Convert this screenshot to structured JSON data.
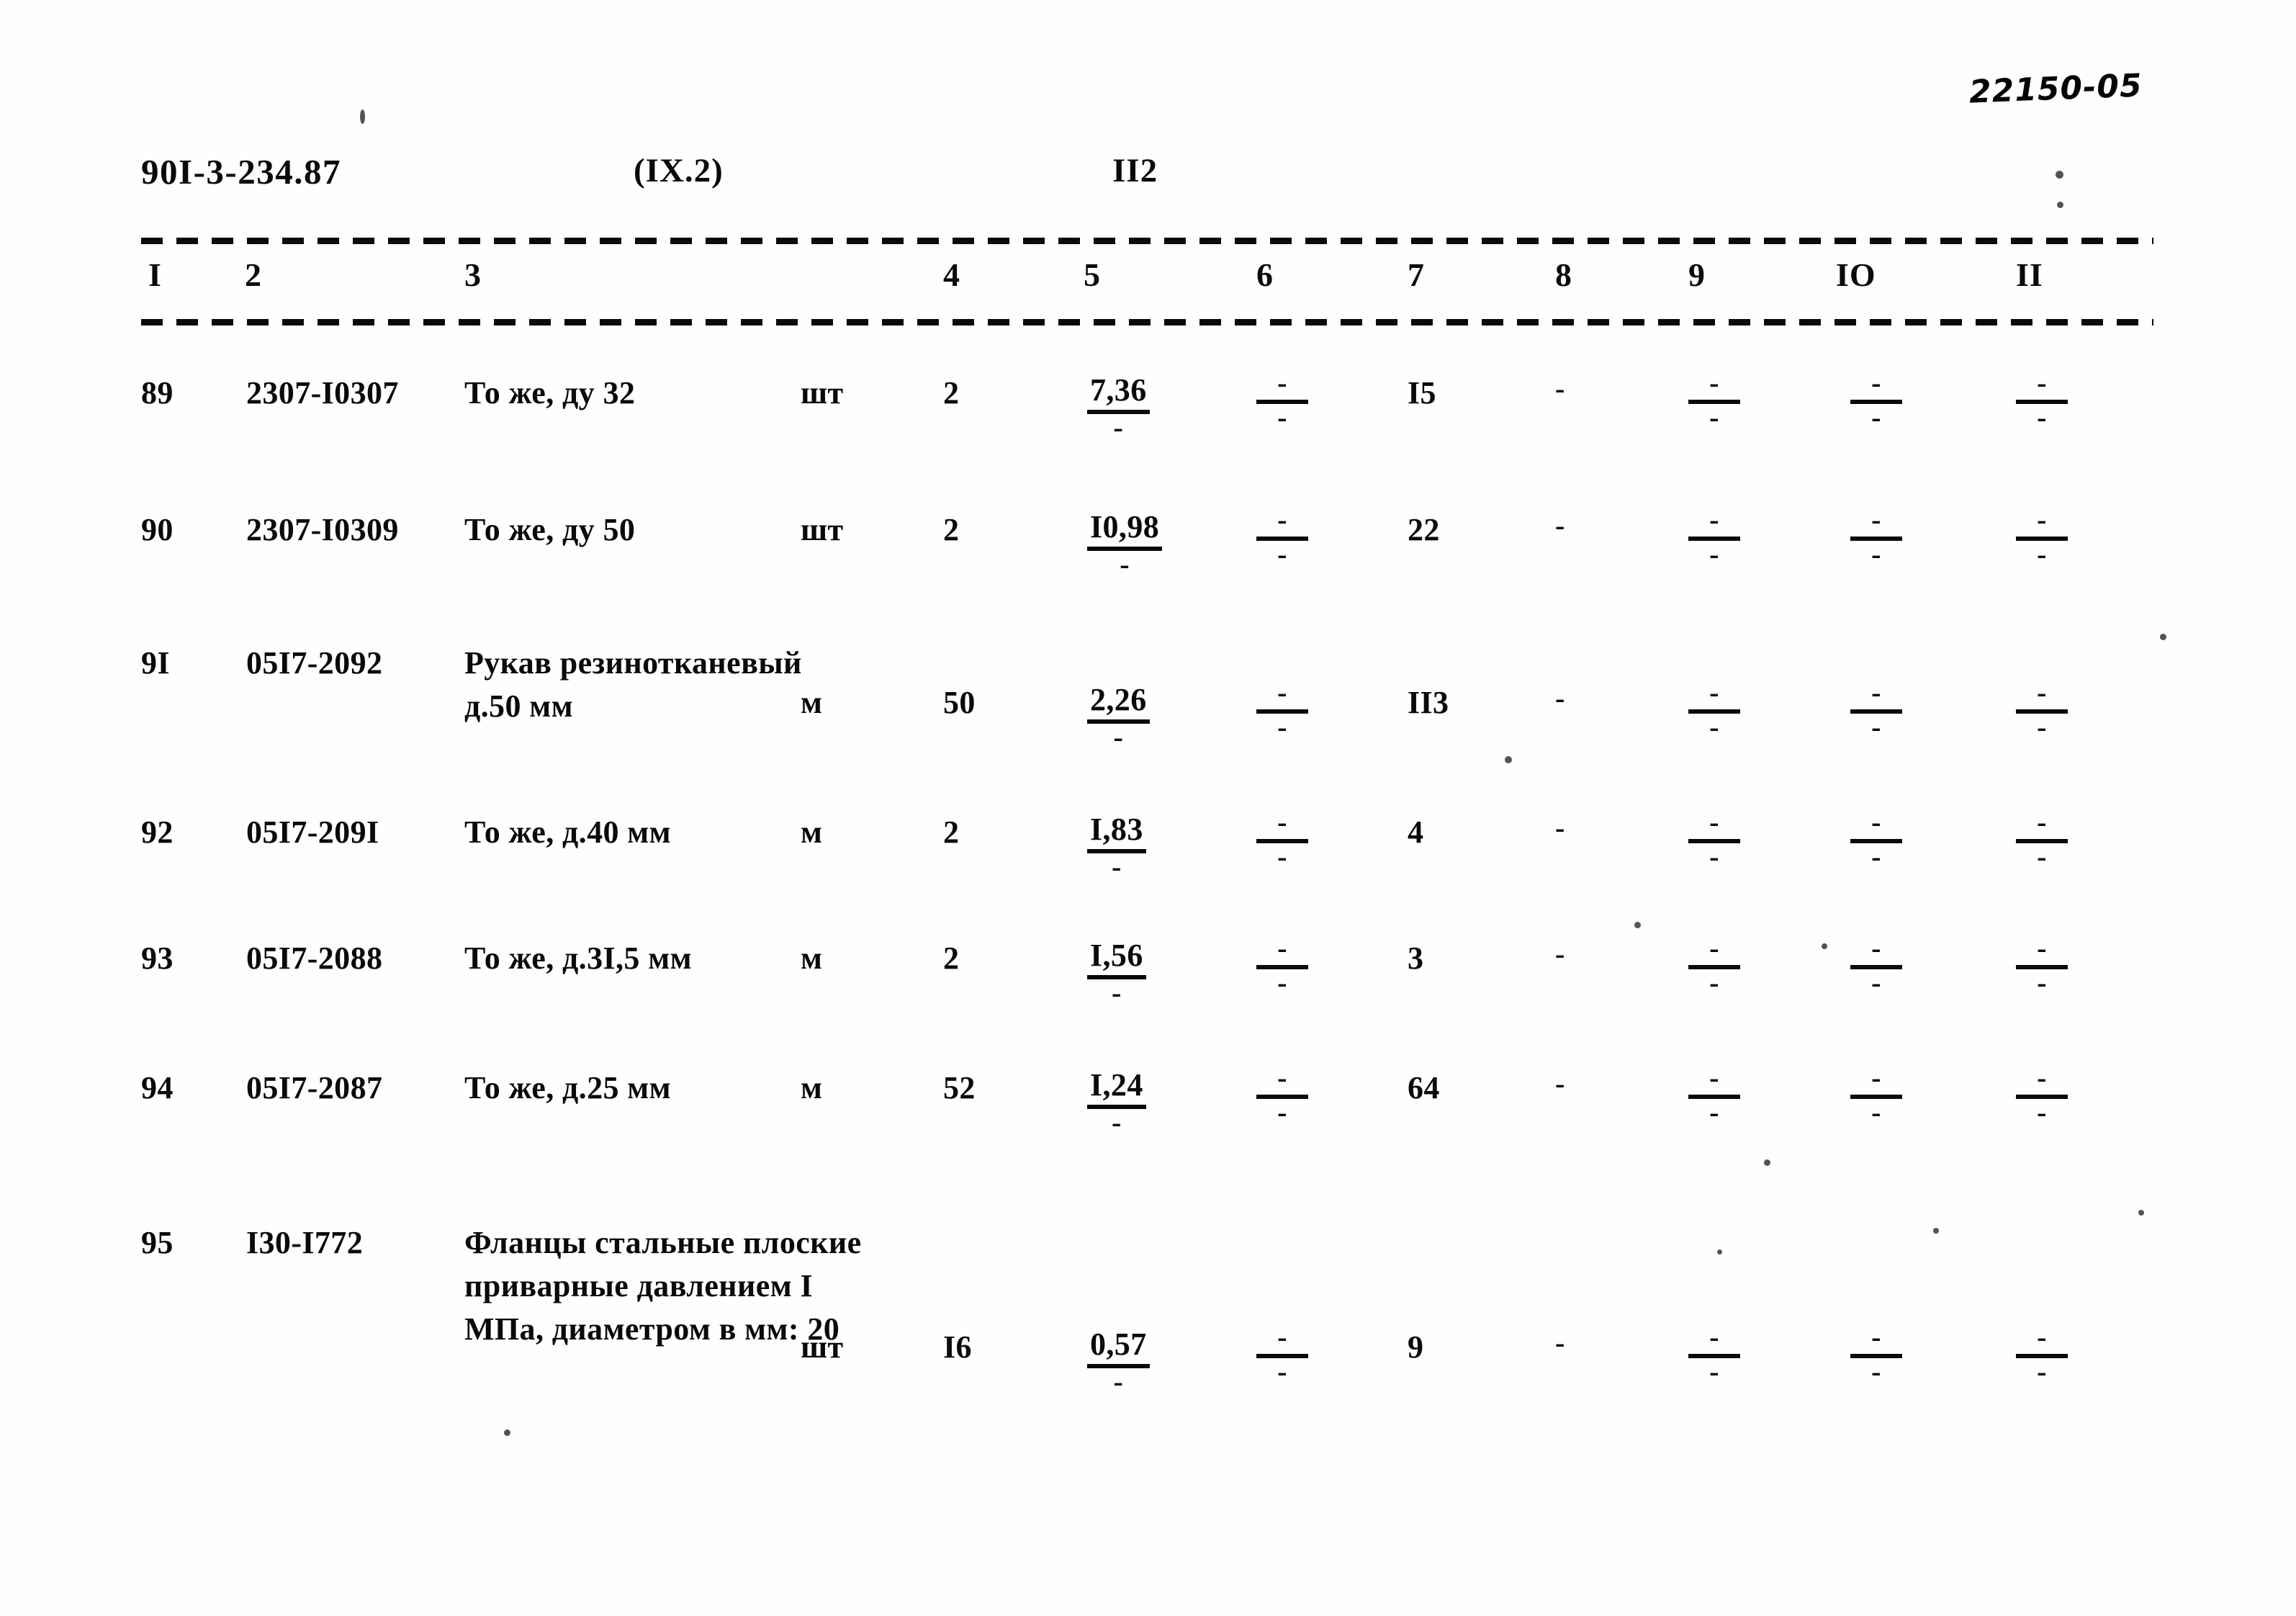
{
  "annotation": {
    "handwritten_note": "22150-05"
  },
  "header": {
    "document_code": "90I-3-234.87",
    "section": "(IX.2)",
    "page_number": "II2"
  },
  "table": {
    "column_headers": [
      "I",
      "2",
      "3",
      "4",
      "5",
      "6",
      "7",
      "8",
      "9",
      "IO",
      "II"
    ],
    "absent_marker": "-",
    "rows": [
      {
        "num": "89",
        "code": "2307-I0307",
        "description": [
          "То же, ду 32"
        ],
        "unit": "шт",
        "qty": "2",
        "price": "7,36",
        "price_den": "-",
        "col6_num": "-",
        "col6_den": "-",
        "col7": "I5",
        "col8": "-",
        "col9_num": "-",
        "col9_den": "-",
        "col10_num": "-",
        "col10_den": "-",
        "col11_num": "-",
        "col11_den": "-"
      },
      {
        "num": "90",
        "code": "2307-I0309",
        "description": [
          "То же, ду 50"
        ],
        "unit": "шт",
        "qty": "2",
        "price": "I0,98",
        "price_den": "-",
        "col6_num": "-",
        "col6_den": "-",
        "col7": "22",
        "col8": "-",
        "col9_num": "-",
        "col9_den": "-",
        "col10_num": "-",
        "col10_den": "-",
        "col11_num": "-",
        "col11_den": "-"
      },
      {
        "num": "9I",
        "code": "05I7-2092",
        "description": [
          "Рукав резинотканевый",
          "д.50 мм"
        ],
        "unit": "м",
        "qty": "50",
        "price": "2,26",
        "price_den": "-",
        "col6_num": "-",
        "col6_den": "-",
        "col7": "II3",
        "col8": "-",
        "col9_num": "-",
        "col9_den": "-",
        "col10_num": "-",
        "col10_den": "-",
        "col11_num": "-",
        "col11_den": "-"
      },
      {
        "num": "92",
        "code": "05I7-209I",
        "description": [
          "То же, д.40 мм"
        ],
        "unit": "м",
        "qty": "2",
        "price": "I,83",
        "price_den": "-",
        "col6_num": "-",
        "col6_den": "-",
        "col7": "4",
        "col8": "-",
        "col9_num": "-",
        "col9_den": "-",
        "col10_num": "-",
        "col10_den": "-",
        "col11_num": "-",
        "col11_den": "-"
      },
      {
        "num": "93",
        "code": "05I7-2088",
        "description": [
          "То же, д.3I,5 мм"
        ],
        "unit": "м",
        "qty": "2",
        "price": "I,56",
        "price_den": "-",
        "col6_num": "-",
        "col6_den": "-",
        "col7": "3",
        "col8": "-",
        "col9_num": "-",
        "col9_den": "-",
        "col10_num": "-",
        "col10_den": "-",
        "col11_num": "-",
        "col11_den": "-"
      },
      {
        "num": "94",
        "code": "05I7-2087",
        "description": [
          "То же, д.25 мм"
        ],
        "unit": "м",
        "qty": "52",
        "price": "I,24",
        "price_den": "-",
        "col6_num": "-",
        "col6_den": "-",
        "col7": "64",
        "col8": "-",
        "col9_num": "-",
        "col9_den": "-",
        "col10_num": "-",
        "col10_den": "-",
        "col11_num": "-",
        "col11_den": "-"
      },
      {
        "num": "95",
        "code": "I30-I772",
        "description": [
          "Фланцы стальные плоские",
          "приварные давлением I",
          "МПа, диаметром в мм: 20"
        ],
        "unit": "шт",
        "qty": "I6",
        "price": "0,57",
        "price_den": "-",
        "col6_num": "-",
        "col6_den": "-",
        "col7": "9",
        "col8": "-",
        "col9_num": "-",
        "col9_den": "-",
        "col10_num": "-",
        "col10_den": "-",
        "col11_num": "-",
        "col11_den": "-"
      }
    ]
  }
}
